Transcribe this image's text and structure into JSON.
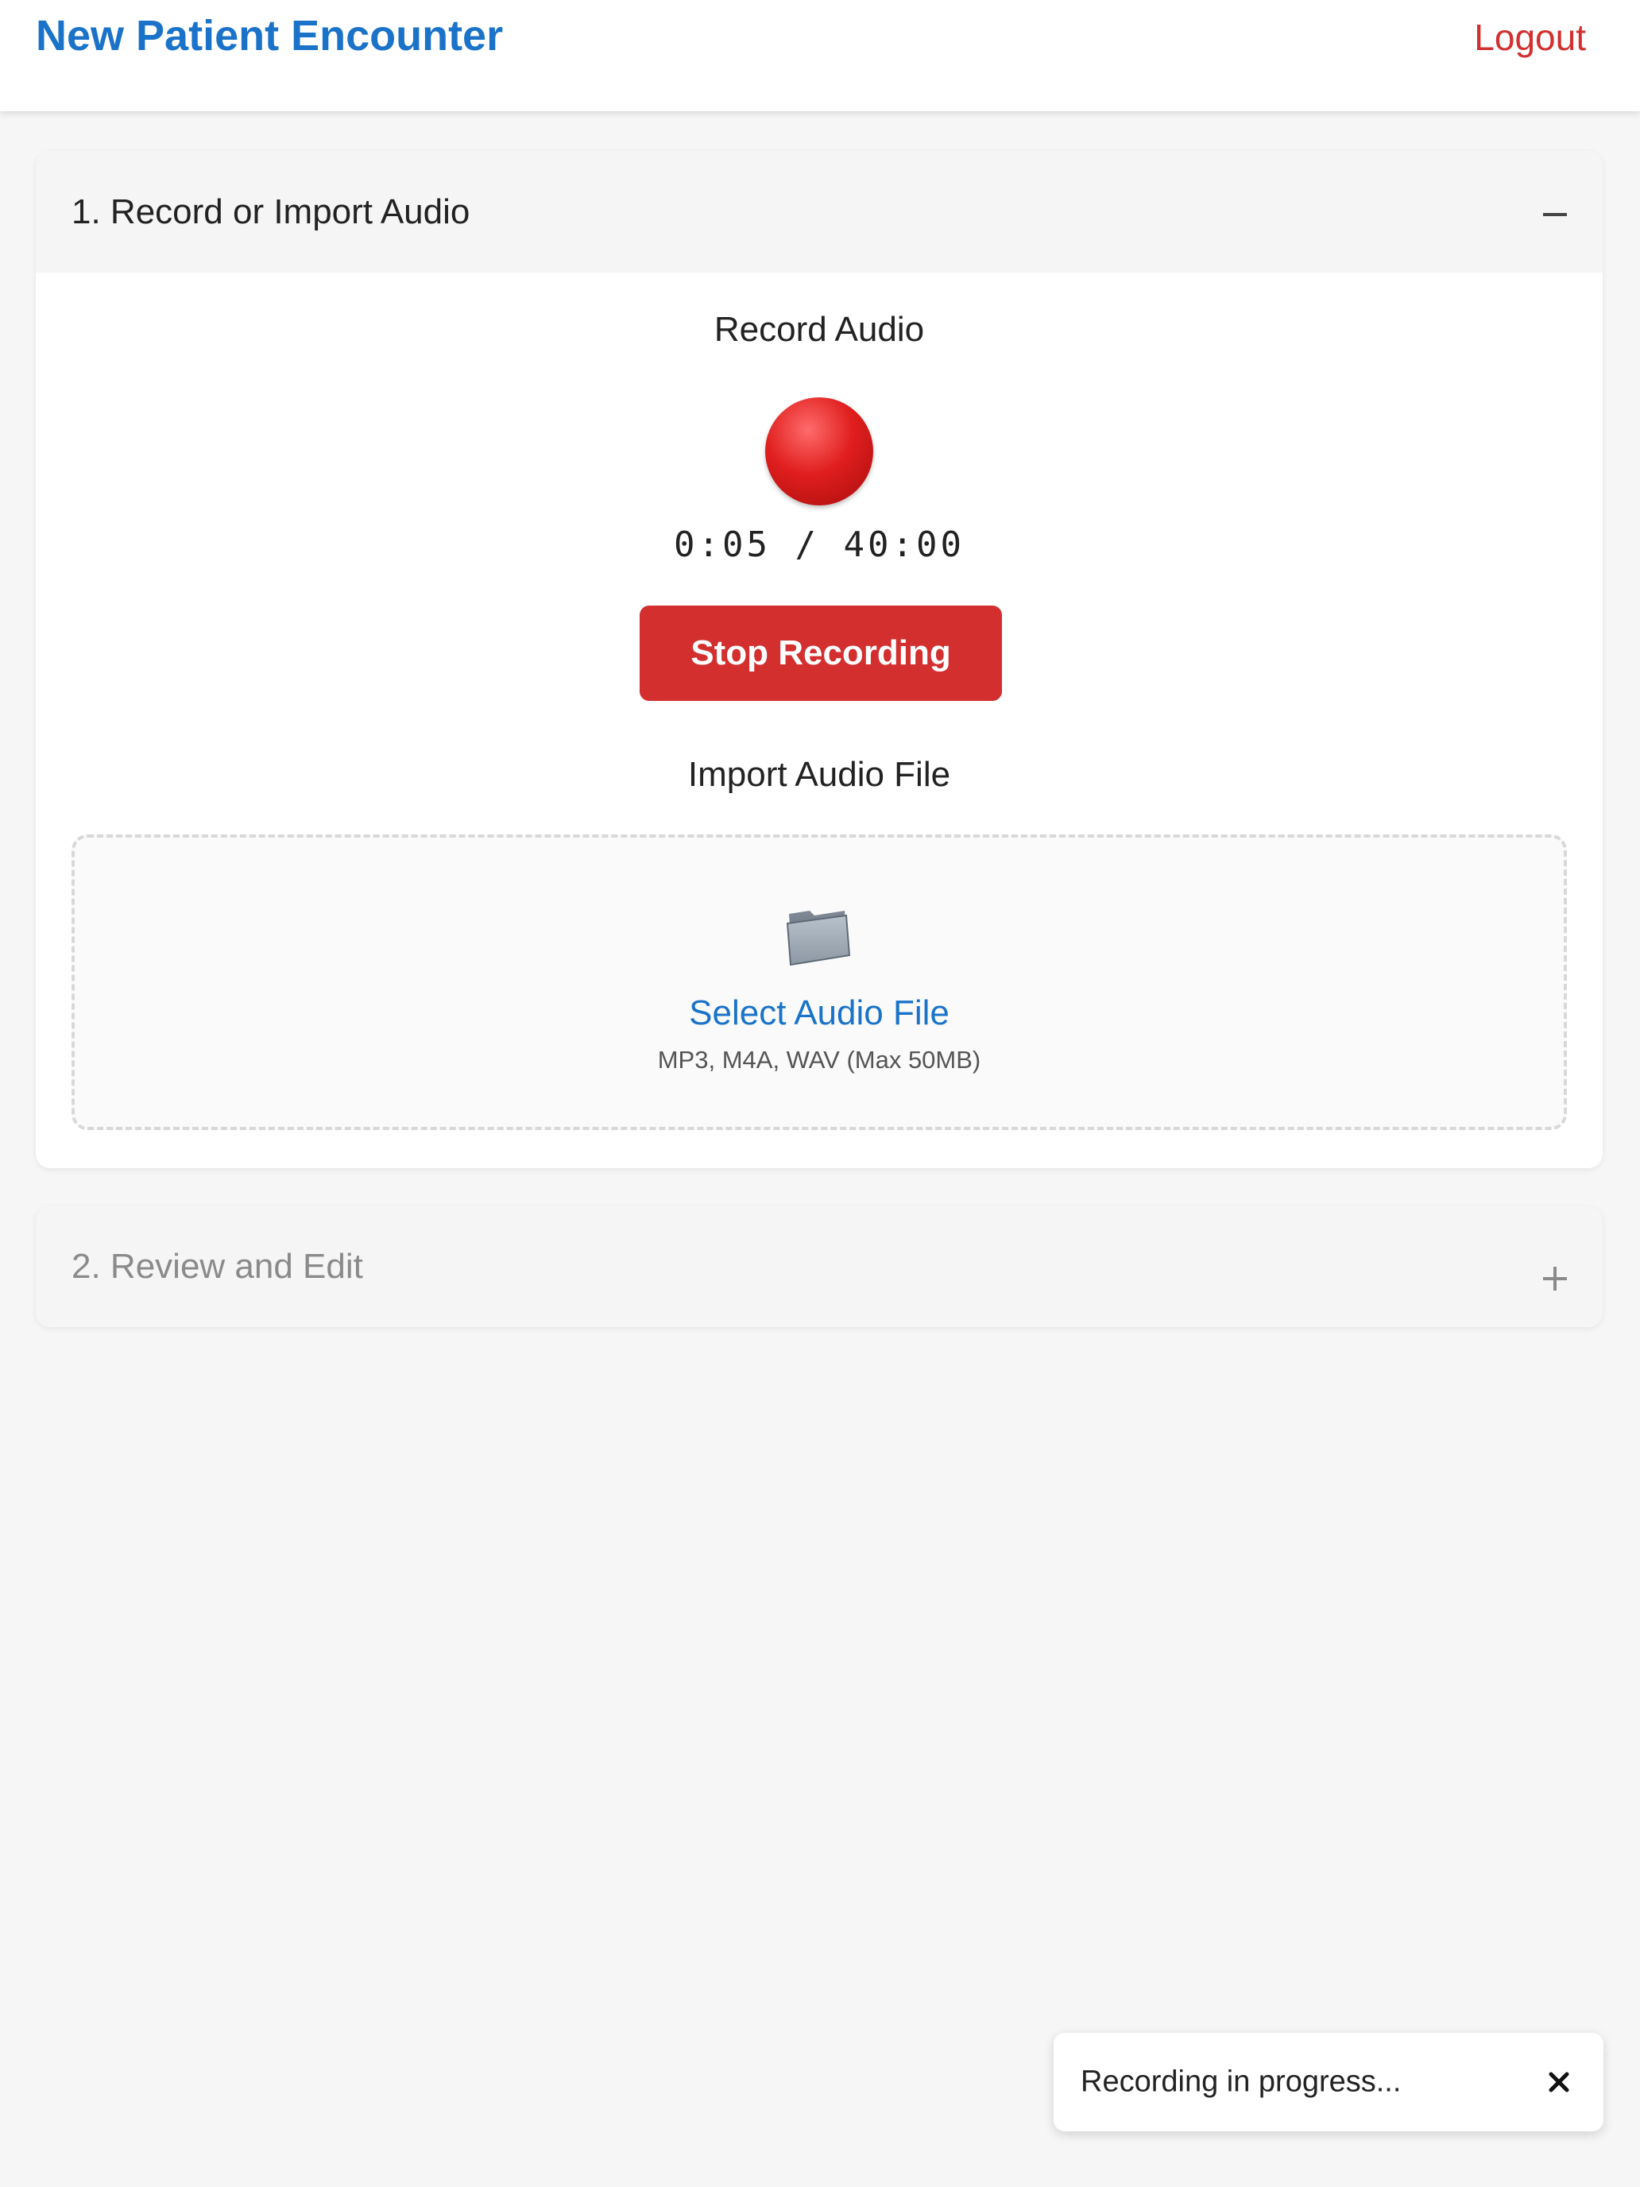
{
  "header": {
    "title": "New Patient Encounter",
    "logout_label": "Logout"
  },
  "section1": {
    "title": "1. Record or Import Audio",
    "toggle_icon": "minus-icon",
    "record_heading": "Record Audio",
    "record_indicator_icon": "red-circle-icon",
    "timer": "0:05 / 40:00",
    "stop_button_label": "Stop Recording",
    "import_heading": "Import Audio File",
    "dropzone": {
      "icon": "folder-icon",
      "select_label": "Select Audio File",
      "hint": "MP3, M4A, WAV (Max 50MB)"
    }
  },
  "section2": {
    "title": "2. Review and Edit",
    "toggle_icon": "plus-icon"
  },
  "toast": {
    "message": "Recording in progress...",
    "close_icon": "close-icon"
  },
  "colors": {
    "brand_blue": "#1a73c9",
    "danger_red": "#d32f2f",
    "page_background": "#f6f6f6"
  }
}
